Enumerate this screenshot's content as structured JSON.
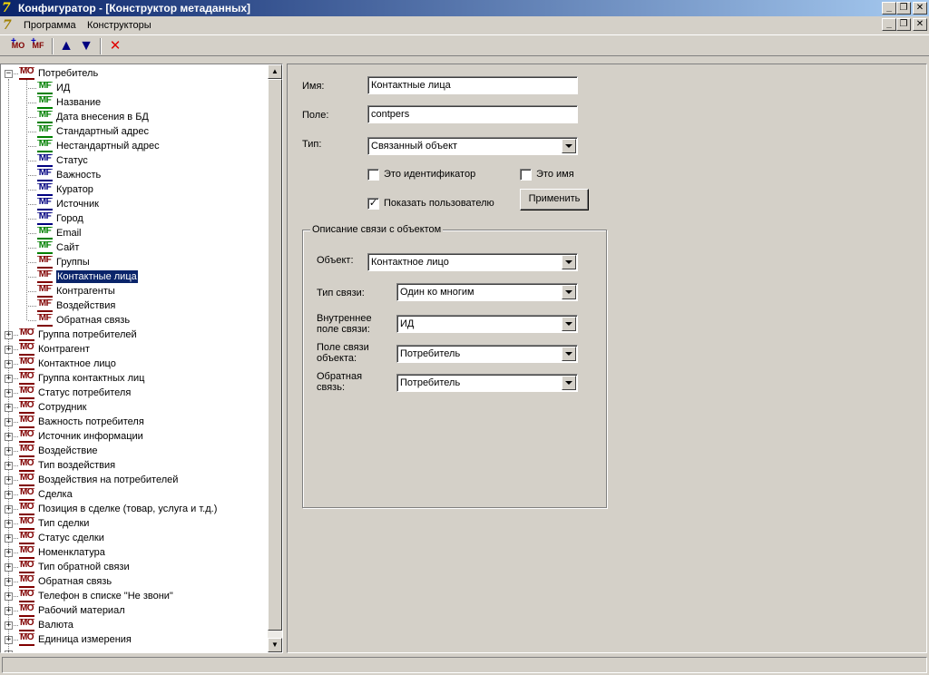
{
  "window": {
    "title": "Конфигуратор - [Конструктор метаданных]",
    "app_icon_glyph": "7"
  },
  "menu": {
    "items": [
      "Программа",
      "Конструкторы"
    ]
  },
  "toolbar": {
    "add_object_label": "MO",
    "add_field_label": "MF",
    "move_up_glyph": "🡅",
    "move_down_glyph": "🡇",
    "delete_glyph": "✕"
  },
  "tree": {
    "root": {
      "badge": "MO",
      "label": "Потребитель",
      "expanded": true
    },
    "fields": [
      {
        "badge": "MF",
        "color": "#008000",
        "label": "ИД"
      },
      {
        "badge": "MF",
        "color": "#008000",
        "label": "Название"
      },
      {
        "badge": "MF",
        "color": "#008000",
        "label": "Дата внесения в БД"
      },
      {
        "badge": "MF",
        "color": "#008000",
        "label": "Стандартный адрес"
      },
      {
        "badge": "MF",
        "color": "#008000",
        "label": "Нестандартный адрес"
      },
      {
        "badge": "MF",
        "color": "#000080",
        "label": "Статус"
      },
      {
        "badge": "MF",
        "color": "#000080",
        "label": "Важность"
      },
      {
        "badge": "MF",
        "color": "#000080",
        "label": "Куратор"
      },
      {
        "badge": "MF",
        "color": "#000080",
        "label": "Источник"
      },
      {
        "badge": "MF",
        "color": "#000080",
        "label": "Город"
      },
      {
        "badge": "MF",
        "color": "#008000",
        "label": "Email"
      },
      {
        "badge": "MF",
        "color": "#008000",
        "label": "Сайт"
      },
      {
        "badge": "MF",
        "color": "#800000",
        "label": "Группы"
      },
      {
        "badge": "MF",
        "color": "#800000",
        "label": "Контактные лица",
        "selected": true
      },
      {
        "badge": "MF",
        "color": "#800000",
        "label": "Контрагенты"
      },
      {
        "badge": "MF",
        "color": "#800000",
        "label": "Воздействия"
      },
      {
        "badge": "MF",
        "color": "#800000",
        "label": "Обратная связь"
      }
    ],
    "objects": [
      {
        "badge": "MO",
        "label": "Группа потребителей"
      },
      {
        "badge": "MO",
        "label": "Контрагент"
      },
      {
        "badge": "MO",
        "label": "Контактное лицо"
      },
      {
        "badge": "MO",
        "label": "Группа контактных лиц"
      },
      {
        "badge": "MO",
        "label": "Статус потребителя"
      },
      {
        "badge": "MO",
        "label": "Сотрудник"
      },
      {
        "badge": "MO",
        "label": "Важность потребителя"
      },
      {
        "badge": "MO",
        "label": "Источник информации"
      },
      {
        "badge": "MO",
        "label": "Воздействие"
      },
      {
        "badge": "MO",
        "label": "Тип воздействия"
      },
      {
        "badge": "MO",
        "label": "Воздействия на потребителей"
      },
      {
        "badge": "MO",
        "label": "Сделка"
      },
      {
        "badge": "MO",
        "label": "Позиция в сделке (товар, услуга и т.д.)"
      },
      {
        "badge": "MO",
        "label": "Тип сделки"
      },
      {
        "badge": "MO",
        "label": "Статус сделки"
      },
      {
        "badge": "MO",
        "label": "Номенклатура"
      },
      {
        "badge": "MO",
        "label": "Тип обратной связи"
      },
      {
        "badge": "MO",
        "label": "Обратная связь"
      },
      {
        "badge": "MO",
        "label": "Телефон в списке \"Не звони\""
      },
      {
        "badge": "MO",
        "label": "Рабочий материал"
      },
      {
        "badge": "MO",
        "label": "Валюта"
      },
      {
        "badge": "MO",
        "label": "Единица измерения"
      }
    ],
    "mo_color": "#800000"
  },
  "form": {
    "name_label": "Имя:",
    "name_value": "Контактные лица",
    "field_label": "Поле:",
    "field_value": "contpers",
    "type_label": "Тип:",
    "type_value": "Связанный объект",
    "is_identifier_label": "Это идентификатор",
    "is_identifier_checked": false,
    "is_name_label": "Это имя",
    "is_name_checked": false,
    "show_user_label": "Показать пользователю",
    "show_user_checked": true,
    "apply_label": "Применить"
  },
  "relation": {
    "group_title": "Описание связи с объектом",
    "object_label": "Объект:",
    "object_value": "Контактное лицо",
    "link_type_label": "Тип связи:",
    "link_type_value": "Один ко многим",
    "inner_field_label_1": "Внутреннее",
    "inner_field_label_2": "поле связи:",
    "inner_field_value": "ИД",
    "object_field_label_1": "Поле связи",
    "object_field_label_2": "объекта:",
    "object_field_value": "Потребитель",
    "back_link_label_1": "Обратная",
    "back_link_label_2": "связь:",
    "back_link_value": "Потребитель"
  }
}
